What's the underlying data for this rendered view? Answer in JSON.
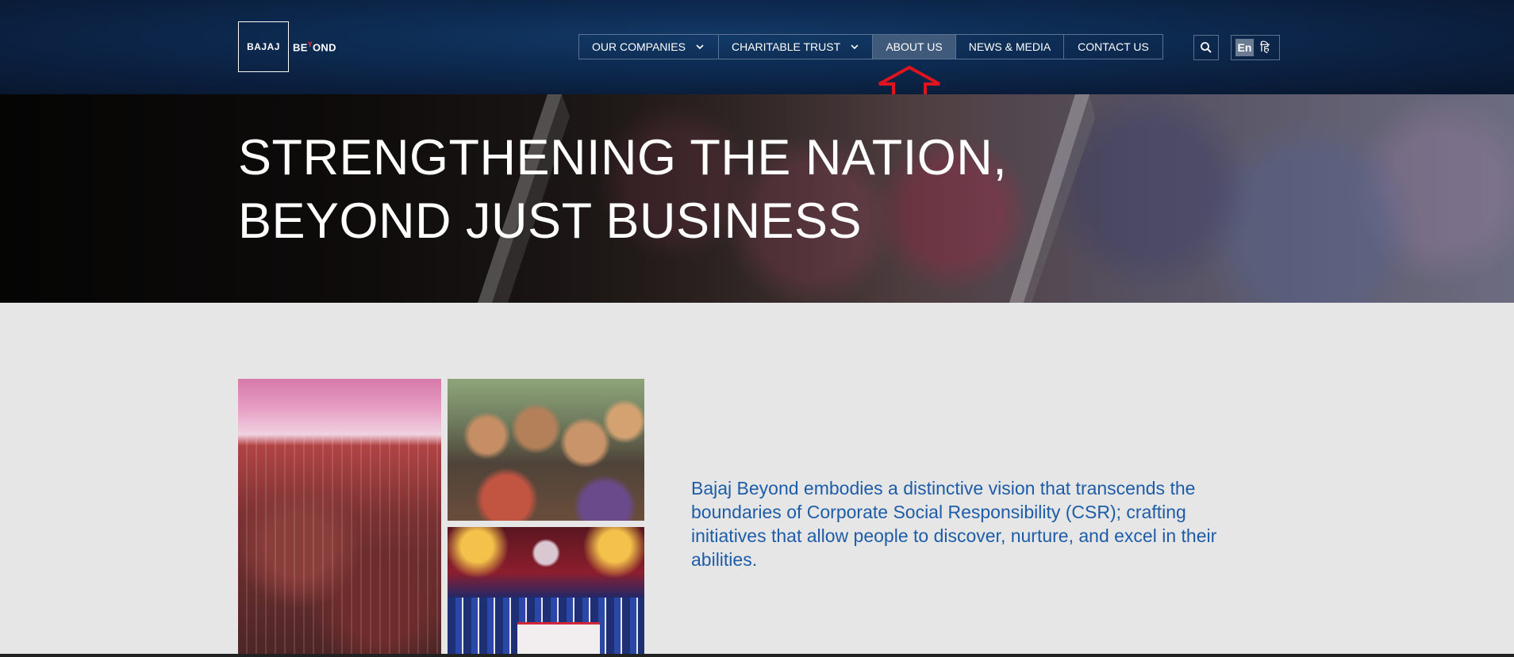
{
  "brand": {
    "logo_box_text": "BAJAJ",
    "logo_wordmark": "BE",
    "logo_wordmark_accent": "Y",
    "logo_wordmark_rest": "OND"
  },
  "nav": {
    "items": [
      {
        "label": "OUR COMPANIES",
        "has_dropdown": true,
        "active": false
      },
      {
        "label": "CHARITABLE TRUST",
        "has_dropdown": true,
        "active": false
      },
      {
        "label": "ABOUT US",
        "has_dropdown": false,
        "active": true
      },
      {
        "label": "NEWS & MEDIA",
        "has_dropdown": false,
        "active": false
      },
      {
        "label": "CONTACT US",
        "has_dropdown": false,
        "active": false
      }
    ],
    "search_icon": "search-icon",
    "lang_en": "En",
    "lang_hi": "हि"
  },
  "hero": {
    "title_line1": "STRENGTHENING THE NATION,",
    "title_line2": "BEYOND JUST BUSINESS"
  },
  "intro": {
    "text": "Bajaj Beyond embodies a distinctive vision that transcends the boundaries of Corporate Social Responsibility (CSR); crafting initiatives that allow people to discover, nurture, and excel in their abilities."
  },
  "colors": {
    "header_bg": "#0d2b52",
    "active_nav_bg": "#3f5a7a",
    "intro_text": "#1d5da8",
    "annotation_arrow": "#e0141e",
    "page_bg": "#e6e6e6"
  }
}
